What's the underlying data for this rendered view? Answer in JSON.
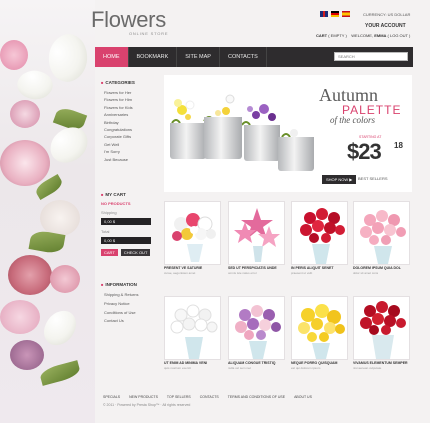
{
  "logo": {
    "title": "Flowers",
    "subtitle": "ONLINE STORE"
  },
  "header": {
    "currency": "CURRENCY: US DOLLAR",
    "account_title": "YOUR ACCOUNT",
    "cart_label": "CART",
    "cart_status": "( EMPTY )",
    "welcome": "WELCOME,",
    "user": "EMMA",
    "logout": "( LOG OUT )"
  },
  "nav": {
    "items": [
      "HOME",
      "BOOKMARK",
      "SITE MAP",
      "CONTACTS"
    ],
    "search_placeholder": "SEARCH"
  },
  "categories": {
    "title": "CATEGORIES",
    "items": [
      "Flowers for Her",
      "Flowers for Him",
      "Flowers for Kids",
      "Anniversaries",
      "Birthday",
      "Congratulations",
      "Corporate Gifts",
      "Get Well",
      "I'm Sorry",
      "Just Because"
    ]
  },
  "cart": {
    "title": "MY CART",
    "empty": "NO PRODUCTS",
    "shipping_label": "Shipping",
    "shipping_value": "0,00 $",
    "total_label": "Total",
    "total_value": "0,00 $",
    "cart_button": "CART",
    "checkout_button": "CHECK OUT"
  },
  "information": {
    "title": "INFORMATION",
    "items": [
      "Shipping & Returns",
      "Privacy Notice",
      "Conditions of Use",
      "Contact Us"
    ]
  },
  "banner": {
    "line1": "Autumn",
    "line2": "PALETTE",
    "line3": "of the colors",
    "starting": "STARTING AT",
    "price": "$23",
    "cents": "18",
    "shop_button": "SHOP NOW ▶",
    "best": "BEST SELLERS"
  },
  "products": [
    {
      "name": "PRESENT VE SATURIE",
      "desc": "curae, aegonisten amet"
    },
    {
      "name": "SED UT PERSPICIATIS UNDE",
      "desc": "omnis iste natus error"
    },
    {
      "name": "IN PERIS ALIQUIT SENET",
      "desc": "praesent ut velit"
    },
    {
      "name": "DOLOREM IPSUM QUIA DOL",
      "desc": "dolor sit amet cons"
    },
    {
      "name": "UT ENIM AD MINIMA VENI",
      "desc": "quis nostrum exercit"
    },
    {
      "name": "ALIQUAM CONGUE TRISTIQ",
      "desc": "nulla vel sem nec"
    },
    {
      "name": "NEQUE PORRO QUISQUAM",
      "desc": "est qui dolorem ipsum"
    },
    {
      "name": "VIVAMUS ELEMENTUM SEMPER",
      "desc": "nisi aenean vulputate"
    }
  ],
  "footer": {
    "links": [
      "SPECIALS",
      "NEW PRODUCTS",
      "TOP SELLERS",
      "CONTACTS",
      "TERMS AND CONDITIONS OF USE",
      "ABOUT US"
    ],
    "copyright": "© 2011 · Powered by Presta Shop™ · All rights reserved"
  },
  "colors": {
    "accent": "#d9426e",
    "nav": "#2e2c2e",
    "page": "#f4f2f2"
  }
}
